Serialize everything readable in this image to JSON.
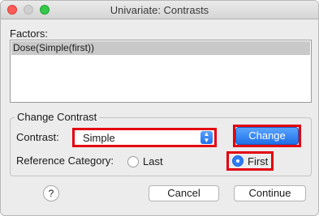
{
  "window": {
    "title": "Univariate: Contrasts"
  },
  "factors": {
    "label": "Factors:",
    "items": [
      "Dose(Simple(first))"
    ]
  },
  "change_contrast": {
    "group_label": "Change Contrast",
    "contrast_label": "Contrast:",
    "contrast_value": "Simple",
    "change_label": "Change",
    "reference_label": "Reference Category:",
    "options": {
      "last": "Last",
      "first": "First"
    },
    "selected": "first"
  },
  "footer": {
    "help_label": "?",
    "cancel_label": "Cancel",
    "continue_label": "Continue"
  },
  "colors": {
    "highlight": "#e3000f",
    "accent": "#2e7cf6"
  },
  "icons": {
    "help": "question-icon",
    "select_arrows": "up-down-chevron-icon"
  }
}
